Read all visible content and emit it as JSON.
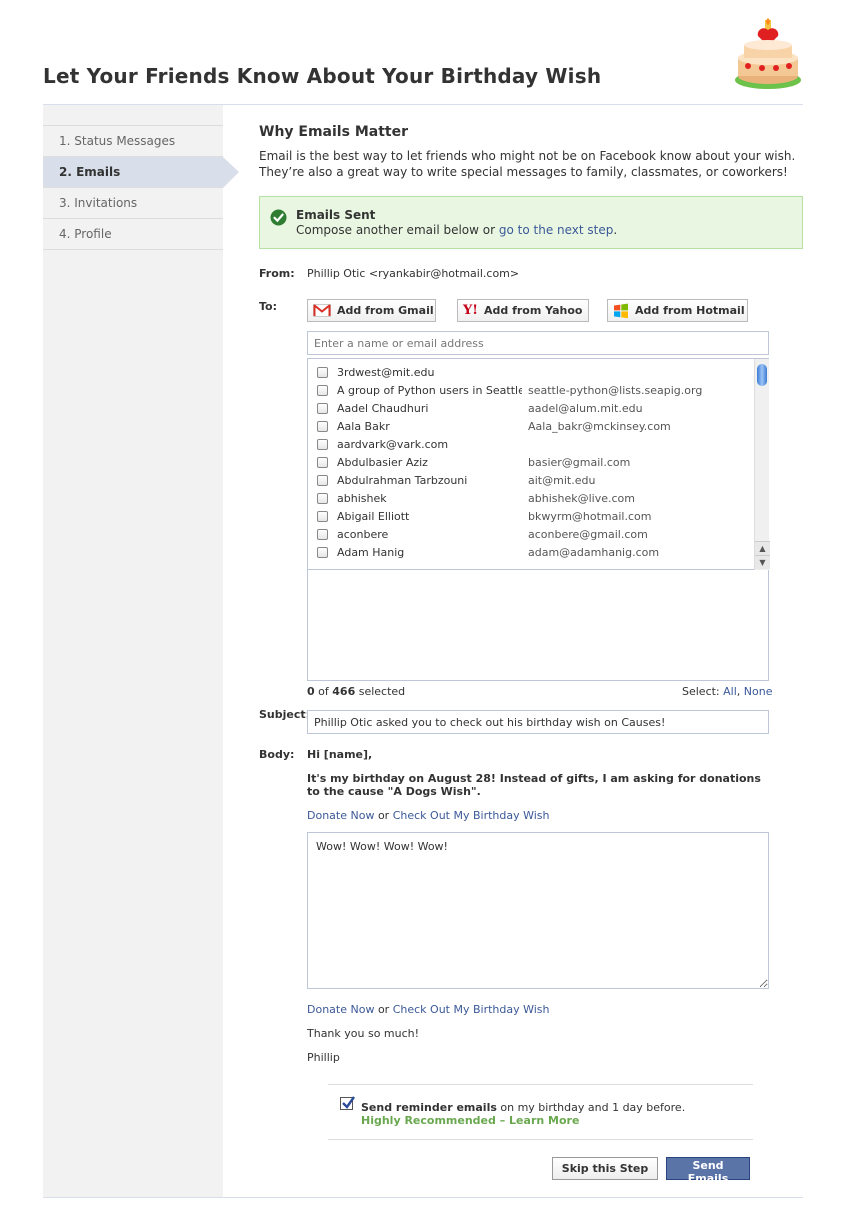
{
  "header": {
    "title": "Let Your Friends Know About Your Birthday Wish"
  },
  "sidebar": {
    "steps": [
      {
        "label": "1. Status Messages"
      },
      {
        "label": "2. Emails"
      },
      {
        "label": "3. Invitations"
      },
      {
        "label": "4. Profile"
      }
    ]
  },
  "main": {
    "heading": "Why Emails Matter",
    "intro_line1": "Email is the best way to let friends who might not be on Facebook know about your wish.",
    "intro_line2": "They’re also a great way to write special messages to family, classmates, or coworkers!",
    "success": {
      "title": "Emails Sent",
      "text": "Compose another email below or ",
      "link": "go to the next step",
      "end": "."
    },
    "from": {
      "label": "From:",
      "value": "Phillip Otic <ryankabir@hotmail.com>"
    },
    "to": {
      "label": "To:",
      "gmail": "Add from Gmail",
      "yahoo": "Add from Yahoo",
      "hotmail": "Add from Hotmail",
      "placeholder": "Enter a name or email address"
    },
    "contacts": [
      {
        "name": "3rdwest@mit.edu",
        "email": ""
      },
      {
        "name": "A group of Python users in Seattle",
        "email": "seattle-python@lists.seapig.org"
      },
      {
        "name": "Aadel Chaudhuri",
        "email": "aadel@alum.mit.edu"
      },
      {
        "name": "Aala Bakr",
        "email": "Aala_bakr@mckinsey.com"
      },
      {
        "name": "aardvark@vark.com",
        "email": ""
      },
      {
        "name": "Abdulbasier Aziz",
        "email": "basier@gmail.com"
      },
      {
        "name": "Abdulrahman Tarbzouni",
        "email": "ait@mit.edu"
      },
      {
        "name": "abhishek",
        "email": "abhishek@live.com"
      },
      {
        "name": "Abigail Elliott",
        "email": "bkwyrm@hotmail.com"
      },
      {
        "name": "aconbere",
        "email": "aconbere@gmail.com"
      },
      {
        "name": "Adam Hanig",
        "email": "adam@adamhanig.com"
      }
    ],
    "selection": {
      "count": "0",
      "of": " of ",
      "total": "466",
      "suffix": " selected",
      "select_label": "Select: ",
      "all": "All",
      "sep": ", ",
      "none": "None"
    },
    "subject": {
      "label": "Subject:",
      "value": "Phillip Otic asked you to check out his birthday wish on Causes!"
    },
    "body": {
      "label": "Body:",
      "greeting": "Hi [name],",
      "paragraph": "It's my birthday on August 28! Instead of gifts, I am asking for donations to the cause \"A Dogs Wish\".",
      "donate": "Donate Now",
      "or": " or ",
      "check_out": "Check Out My Birthday Wish",
      "message": "Wow! Wow! Wow! Wow!",
      "thanks": "Thank you so much!",
      "signature": "Phillip"
    },
    "reminder": {
      "bold": "Send reminder emails",
      "text": " on my birthday and 1 day before.",
      "recommended": "Highly Recommended – ",
      "learn_more": "Learn More",
      "checked": true
    },
    "buttons": {
      "skip": "Skip this Step",
      "send": "Send Emails"
    }
  },
  "colors": {
    "link": "#3b5998",
    "success_bg": "#e9f7e2",
    "success_border": "#b7e0a5",
    "primary_button": "#5b74a8",
    "recommended": "#6aa84f"
  }
}
